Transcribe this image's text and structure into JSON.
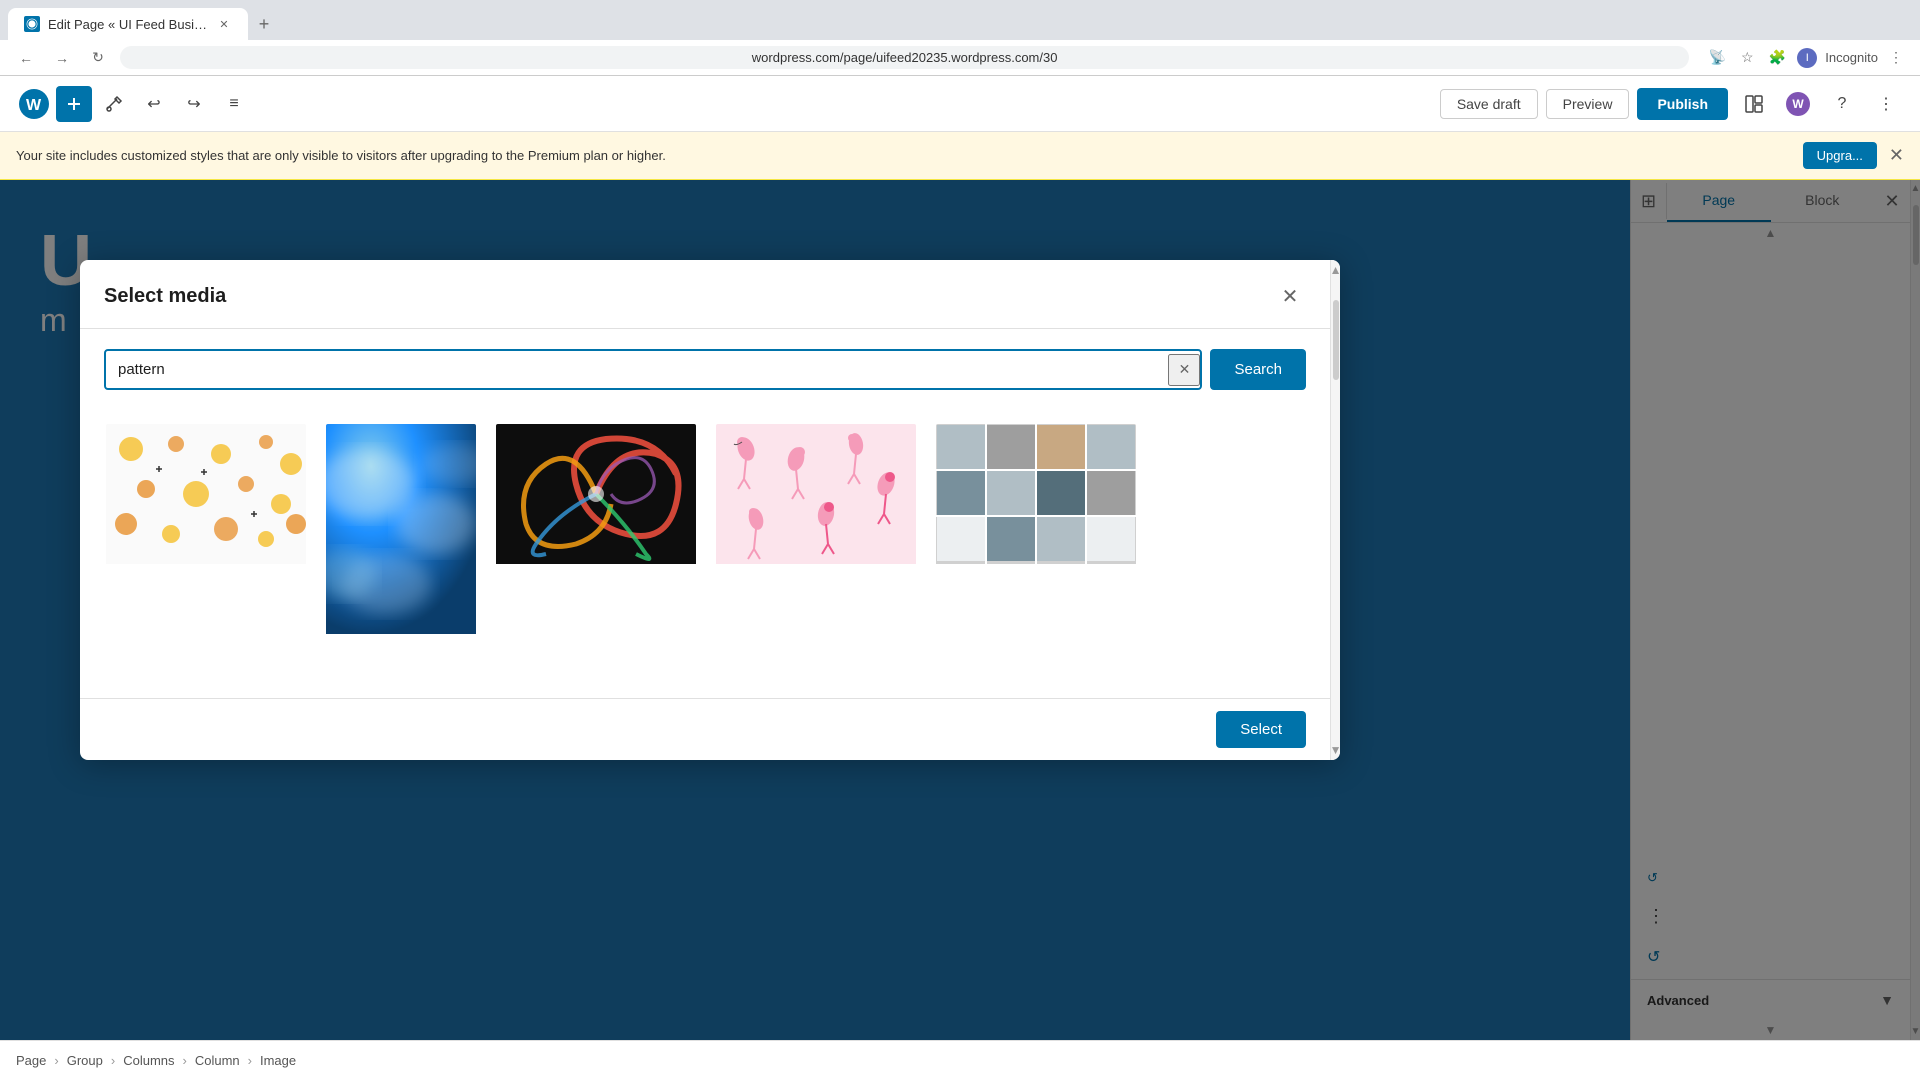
{
  "browser": {
    "tab_title": "Edit Page « UI Feed Business — W",
    "url": "wordpress.com/page/uifeed20235.wordpress.com/30",
    "new_tab_label": "+",
    "incognito_label": "Incognito"
  },
  "toolbar": {
    "save_draft_label": "Save draft",
    "preview_label": "Preview",
    "publish_label": "Publish"
  },
  "notification": {
    "message": "Your site includes customized styles that are only visible to visitors after upgrading to the Premium plan or higher.",
    "upgrade_label": "Upgra..."
  },
  "sidebar": {
    "tab_page": "Page",
    "tab_block": "Block",
    "advanced_label": "Advanced"
  },
  "modal": {
    "title": "Select media",
    "search_placeholder": "pattern",
    "search_value": "pattern",
    "search_button_label": "Search",
    "select_button_label": "Select",
    "images": [
      {
        "id": "polka",
        "alt": "Polka dot pattern on white background"
      },
      {
        "id": "blue",
        "alt": "Blue ice texture pattern"
      },
      {
        "id": "swirl",
        "alt": "Colorful swirl abstract pattern"
      },
      {
        "id": "flamingo",
        "alt": "Pink flamingo pattern on light background"
      },
      {
        "id": "tiles",
        "alt": "Grey and brown tile pattern"
      }
    ]
  },
  "breadcrumb": {
    "items": [
      "Page",
      "Group",
      "Columns",
      "Column",
      "Image"
    ]
  },
  "editor": {
    "text_large": "U",
    "text_small": "m"
  }
}
